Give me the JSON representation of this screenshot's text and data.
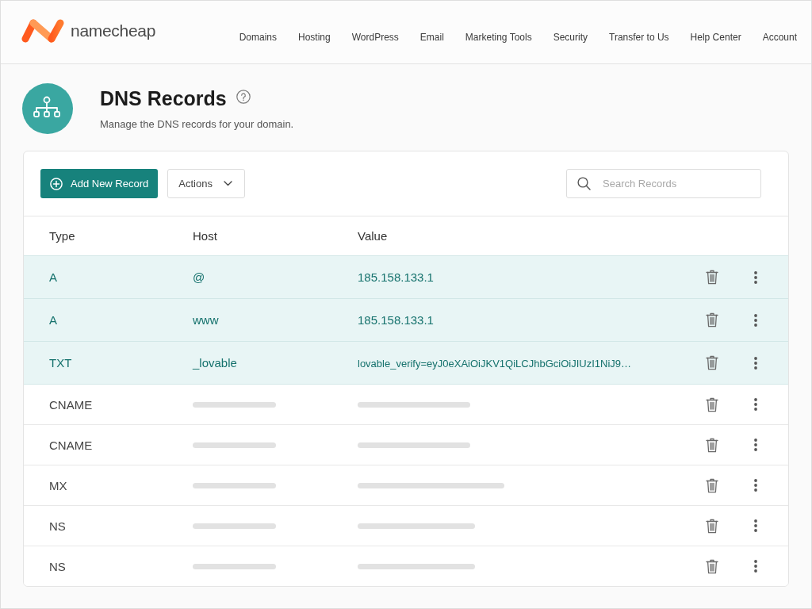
{
  "header": {
    "logo_text": "namecheap",
    "nav": [
      "Domains",
      "Hosting",
      "WordPress",
      "Email",
      "Marketing Tools",
      "Security",
      "Transfer to Us",
      "Help Center",
      "Account"
    ]
  },
  "page": {
    "title": "DNS Records",
    "subtitle": "Manage the DNS records for your domain."
  },
  "toolbar": {
    "add_button": "Add New Record",
    "actions_button": "Actions",
    "search": {
      "placeholder": "Search Records"
    }
  },
  "table": {
    "columns": [
      "Type",
      "Host",
      "Value"
    ],
    "rows": [
      {
        "kind": "record",
        "type": "A",
        "host": "@",
        "value": "185.158.133.1",
        "highlighted": true
      },
      {
        "kind": "record",
        "type": "A",
        "host": "www",
        "value": "185.158.133.1",
        "highlighted": true
      },
      {
        "kind": "record",
        "type": "TXT",
        "host": "_lovable",
        "value": "lovable_verify=eyJ0eXAiOiJKV1QiLCJhbGciOiJIUzI1NiJ9…",
        "highlighted": true
      },
      {
        "kind": "loading",
        "type": "CNAME",
        "highlighted": false
      },
      {
        "kind": "loading",
        "type": "CNAME",
        "highlighted": false
      },
      {
        "kind": "loading",
        "type": "MX",
        "highlighted": false
      },
      {
        "kind": "loading",
        "type": "NS",
        "highlighted": false
      },
      {
        "kind": "loading",
        "type": "NS",
        "highlighted": false
      }
    ]
  }
}
